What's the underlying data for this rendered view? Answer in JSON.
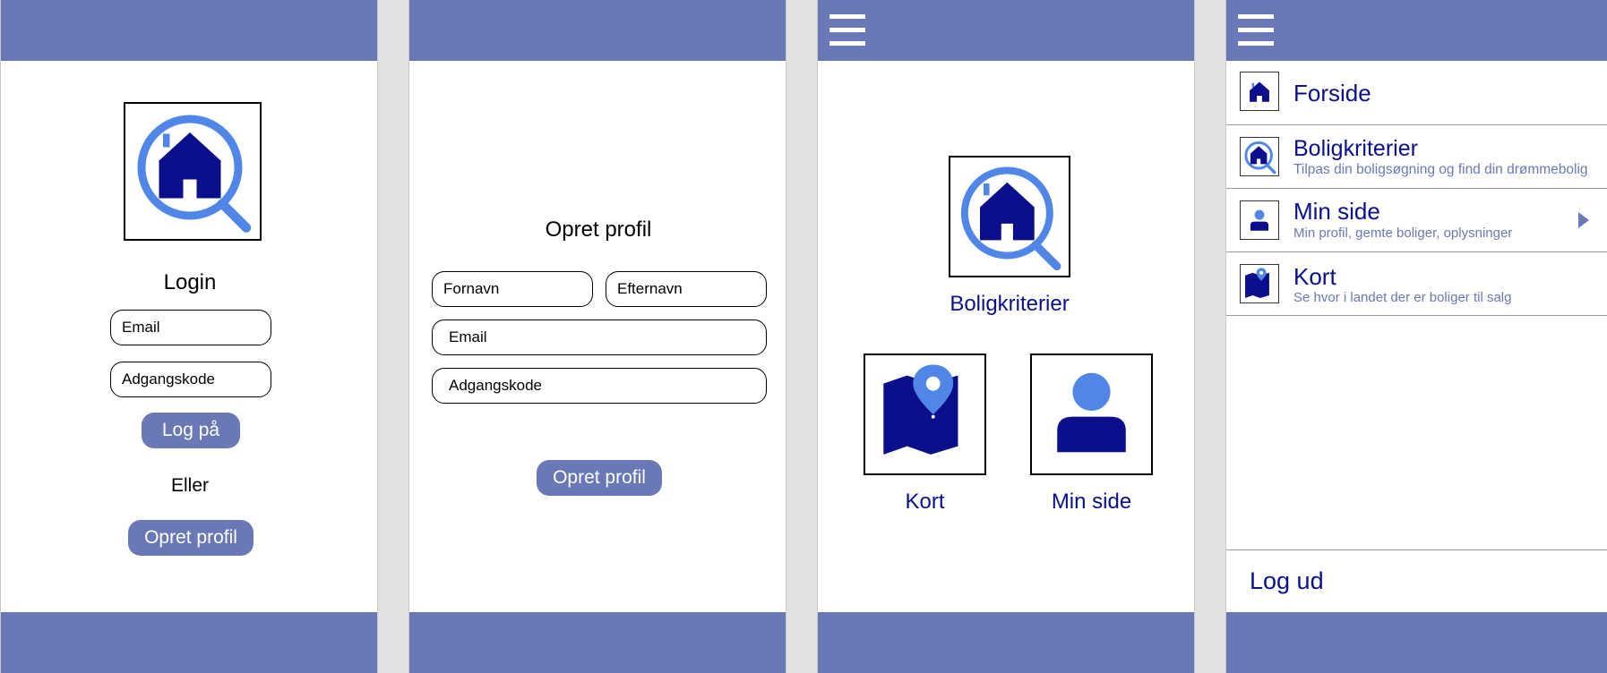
{
  "login": {
    "title": "Login",
    "email_placeholder": "Email",
    "password_placeholder": "Adgangskode",
    "login_button": "Log på",
    "or_text": "Eller",
    "create_button": "Opret profil"
  },
  "create_profile": {
    "title": "Opret profil",
    "firstname_placeholder": "Fornavn",
    "lastname_placeholder": "Efternavn",
    "email_placeholder": "Email",
    "password_placeholder": "Adgangskode",
    "submit_button": "Opret profil"
  },
  "home": {
    "criteria_label": "Boligkriterier",
    "map_label": "Kort",
    "profile_label": "Min side"
  },
  "menu": {
    "items": [
      {
        "title": "Forside",
        "subtitle": "",
        "icon": "house-icon"
      },
      {
        "title": "Boligkriterier",
        "subtitle": "Tilpas din boligsøgning og find din drømmebolig",
        "icon": "house-search-icon"
      },
      {
        "title": "Min side",
        "subtitle": "Min profil, gemte boliger, oplysninger",
        "icon": "person-icon"
      },
      {
        "title": "Kort",
        "subtitle": "Se hvor i landet der er boliger til salg",
        "icon": "map-icon"
      }
    ],
    "logout": "Log ud"
  },
  "colors": {
    "bar": "#6a79b5",
    "navy": "#0b0f8c",
    "accent_blue": "#4f86e8"
  }
}
